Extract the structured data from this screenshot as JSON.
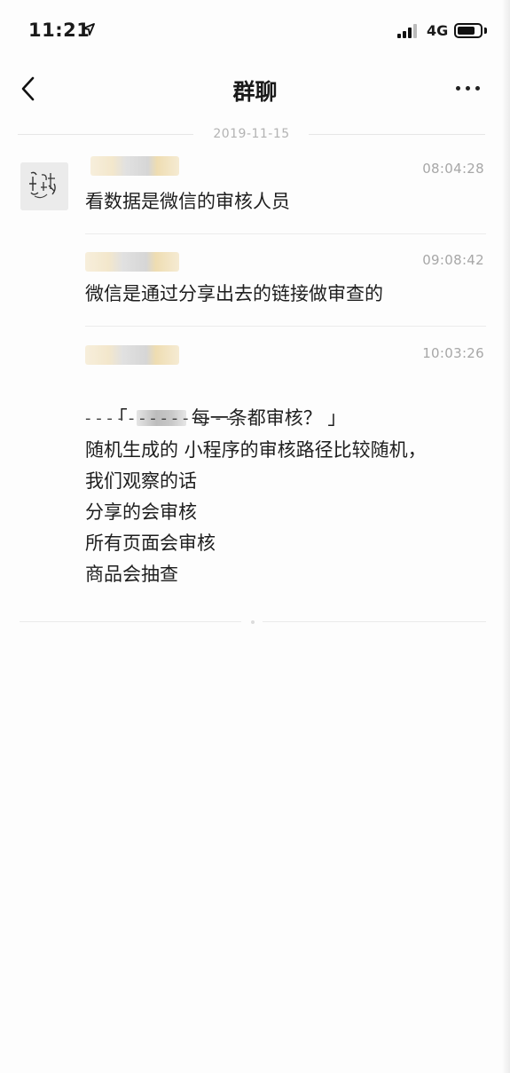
{
  "status_bar": {
    "time": "11:21",
    "network": "4G",
    "battery_level": 0.8
  },
  "nav": {
    "title": "群聊"
  },
  "date_divider": "2019-11-15",
  "messages": [
    {
      "time": "08:04:28",
      "lines": [
        "看数据是微信的审核人员"
      ]
    },
    {
      "time": "09:08:42",
      "lines": [
        "微信是通过分享出去的链接做审查的"
      ]
    },
    {
      "time": "10:03:26",
      "quote_open": "「",
      "quote_text": "每一条都审核？ 」",
      "dashes": "- - - - - - - - - - - - - - -",
      "lines": [
        "随机生成的 小程序的审核路径比较随机，",
        "我们观察的话",
        "分享的会审核",
        "所有页面会审核",
        "商品会抽查"
      ]
    }
  ],
  "icons": {
    "back": "chevron-left-icon",
    "more": "more-dots-icon",
    "location": "location-arrow-icon"
  }
}
